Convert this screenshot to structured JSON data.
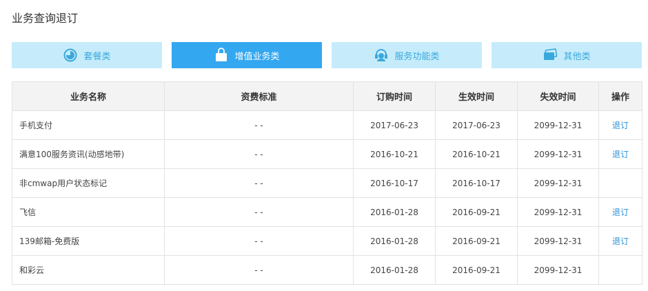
{
  "page": {
    "title": "业务查询退订"
  },
  "tabs": [
    {
      "label": "套餐类",
      "icon": "pie-chart-icon",
      "active": false
    },
    {
      "label": "增值业务类",
      "icon": "shopping-bag-icon",
      "active": true
    },
    {
      "label": "服务功能类",
      "icon": "headset-icon",
      "active": false
    },
    {
      "label": "其他类",
      "icon": "cards-icon",
      "active": false
    }
  ],
  "table": {
    "headers": {
      "name": "业务名称",
      "fee": "资费标准",
      "order_time": "订购时间",
      "effective_time": "生效时间",
      "expire_time": "失效时间",
      "action": "操作"
    },
    "rows": [
      {
        "name": "手机支付",
        "fee": "- -",
        "order_time": "2017-06-23",
        "effective_time": "2017-06-23",
        "expire_time": "2099-12-31",
        "action": "退订"
      },
      {
        "name": "满意100服务资讯(动感地带)",
        "fee": "- -",
        "order_time": "2016-10-21",
        "effective_time": "2016-10-21",
        "expire_time": "2099-12-31",
        "action": "退订"
      },
      {
        "name": "非cmwap用户状态标记",
        "fee": "- -",
        "order_time": "2016-10-17",
        "effective_time": "2016-10-17",
        "expire_time": "2099-12-31",
        "action": ""
      },
      {
        "name": "飞信",
        "fee": "- -",
        "order_time": "2016-01-28",
        "effective_time": "2016-09-21",
        "expire_time": "2099-12-31",
        "action": "退订"
      },
      {
        "name": "139邮箱-免费版",
        "fee": "- -",
        "order_time": "2016-01-28",
        "effective_time": "2016-09-21",
        "expire_time": "2099-12-31",
        "action": "退订"
      },
      {
        "name": "和彩云",
        "fee": "- -",
        "order_time": "2016-01-28",
        "effective_time": "2016-09-21",
        "expire_time": "2099-12-31",
        "action": ""
      }
    ]
  },
  "colors": {
    "tab_inactive_bg": "#c6ecfb",
    "tab_active_bg": "#33a7ef",
    "link": "#2b8fd6"
  }
}
